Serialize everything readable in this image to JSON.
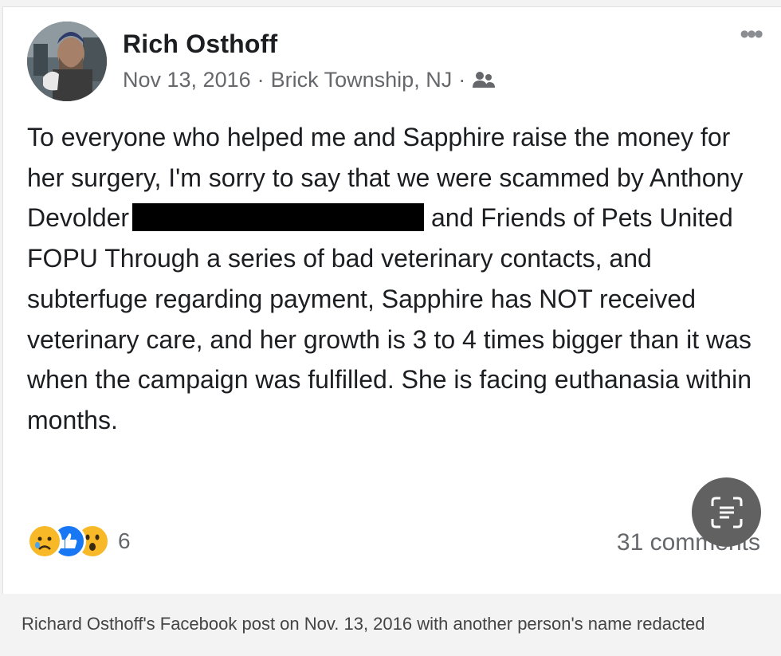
{
  "post": {
    "author": "Rich Osthoff",
    "date": "Nov 13, 2016",
    "separator": "·",
    "location": "Brick Township, NJ",
    "audience_icon": "friends-icon",
    "more_icon": "more-options-icon",
    "more_label": "•••",
    "body_before_redaction": "To everyone who helped me and Sapphire raise the money for her surgery, I'm sorry to say that we were scammed by Anthony Devolder",
    "body_after_redaction": "and Friends of Pets United FOPU Through a series of bad veterinary contacts, and subterfuge regarding payment, Sapphire has NOT received veterinary care, and her growth is 3 to 4 times bigger than it was when the campaign was fulfilled. She is facing euthanasia within months.",
    "reactions": {
      "icons": [
        "sad-reaction-icon",
        "like-reaction-icon",
        "wow-reaction-icon"
      ],
      "count": "6"
    },
    "comments": "31 comments"
  },
  "overlay": {
    "icon": "text-scan-icon"
  },
  "caption": "Richard Osthoff's Facebook post on Nov. 13, 2016 with another person's name redacted",
  "colors": {
    "like_blue": "#1877f2",
    "reaction_yellow": "#f7b928",
    "meta_grey": "#65676b"
  }
}
